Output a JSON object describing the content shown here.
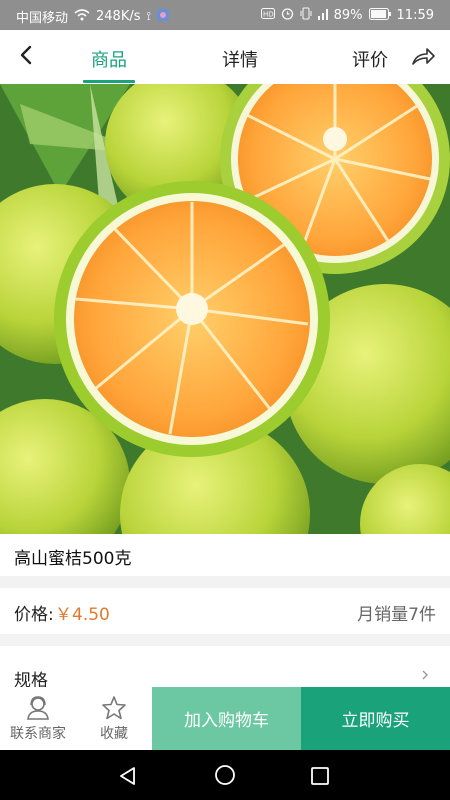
{
  "status_bar": {
    "carrier": "中国移动",
    "network_speed": "248K/s",
    "battery": "89%",
    "time": "11:59"
  },
  "top_bar": {
    "tabs": [
      {
        "label": "商品",
        "active": true
      },
      {
        "label": "详情",
        "active": false
      },
      {
        "label": "评价",
        "active": false
      }
    ],
    "accent_color": "#1aa37a"
  },
  "carousel": {
    "pages": 3,
    "active_page": 1
  },
  "product": {
    "title": "高山蜜桔500克",
    "price_label": "价格:",
    "price_value": "￥4.50",
    "monthly_sales": "月销量7件",
    "spec_label": "规格"
  },
  "bottom_bar": {
    "contact_label": "联系商家",
    "favorite_label": "收藏",
    "add_to_cart_label": "加入购物车",
    "buy_now_label": "立即购买"
  }
}
